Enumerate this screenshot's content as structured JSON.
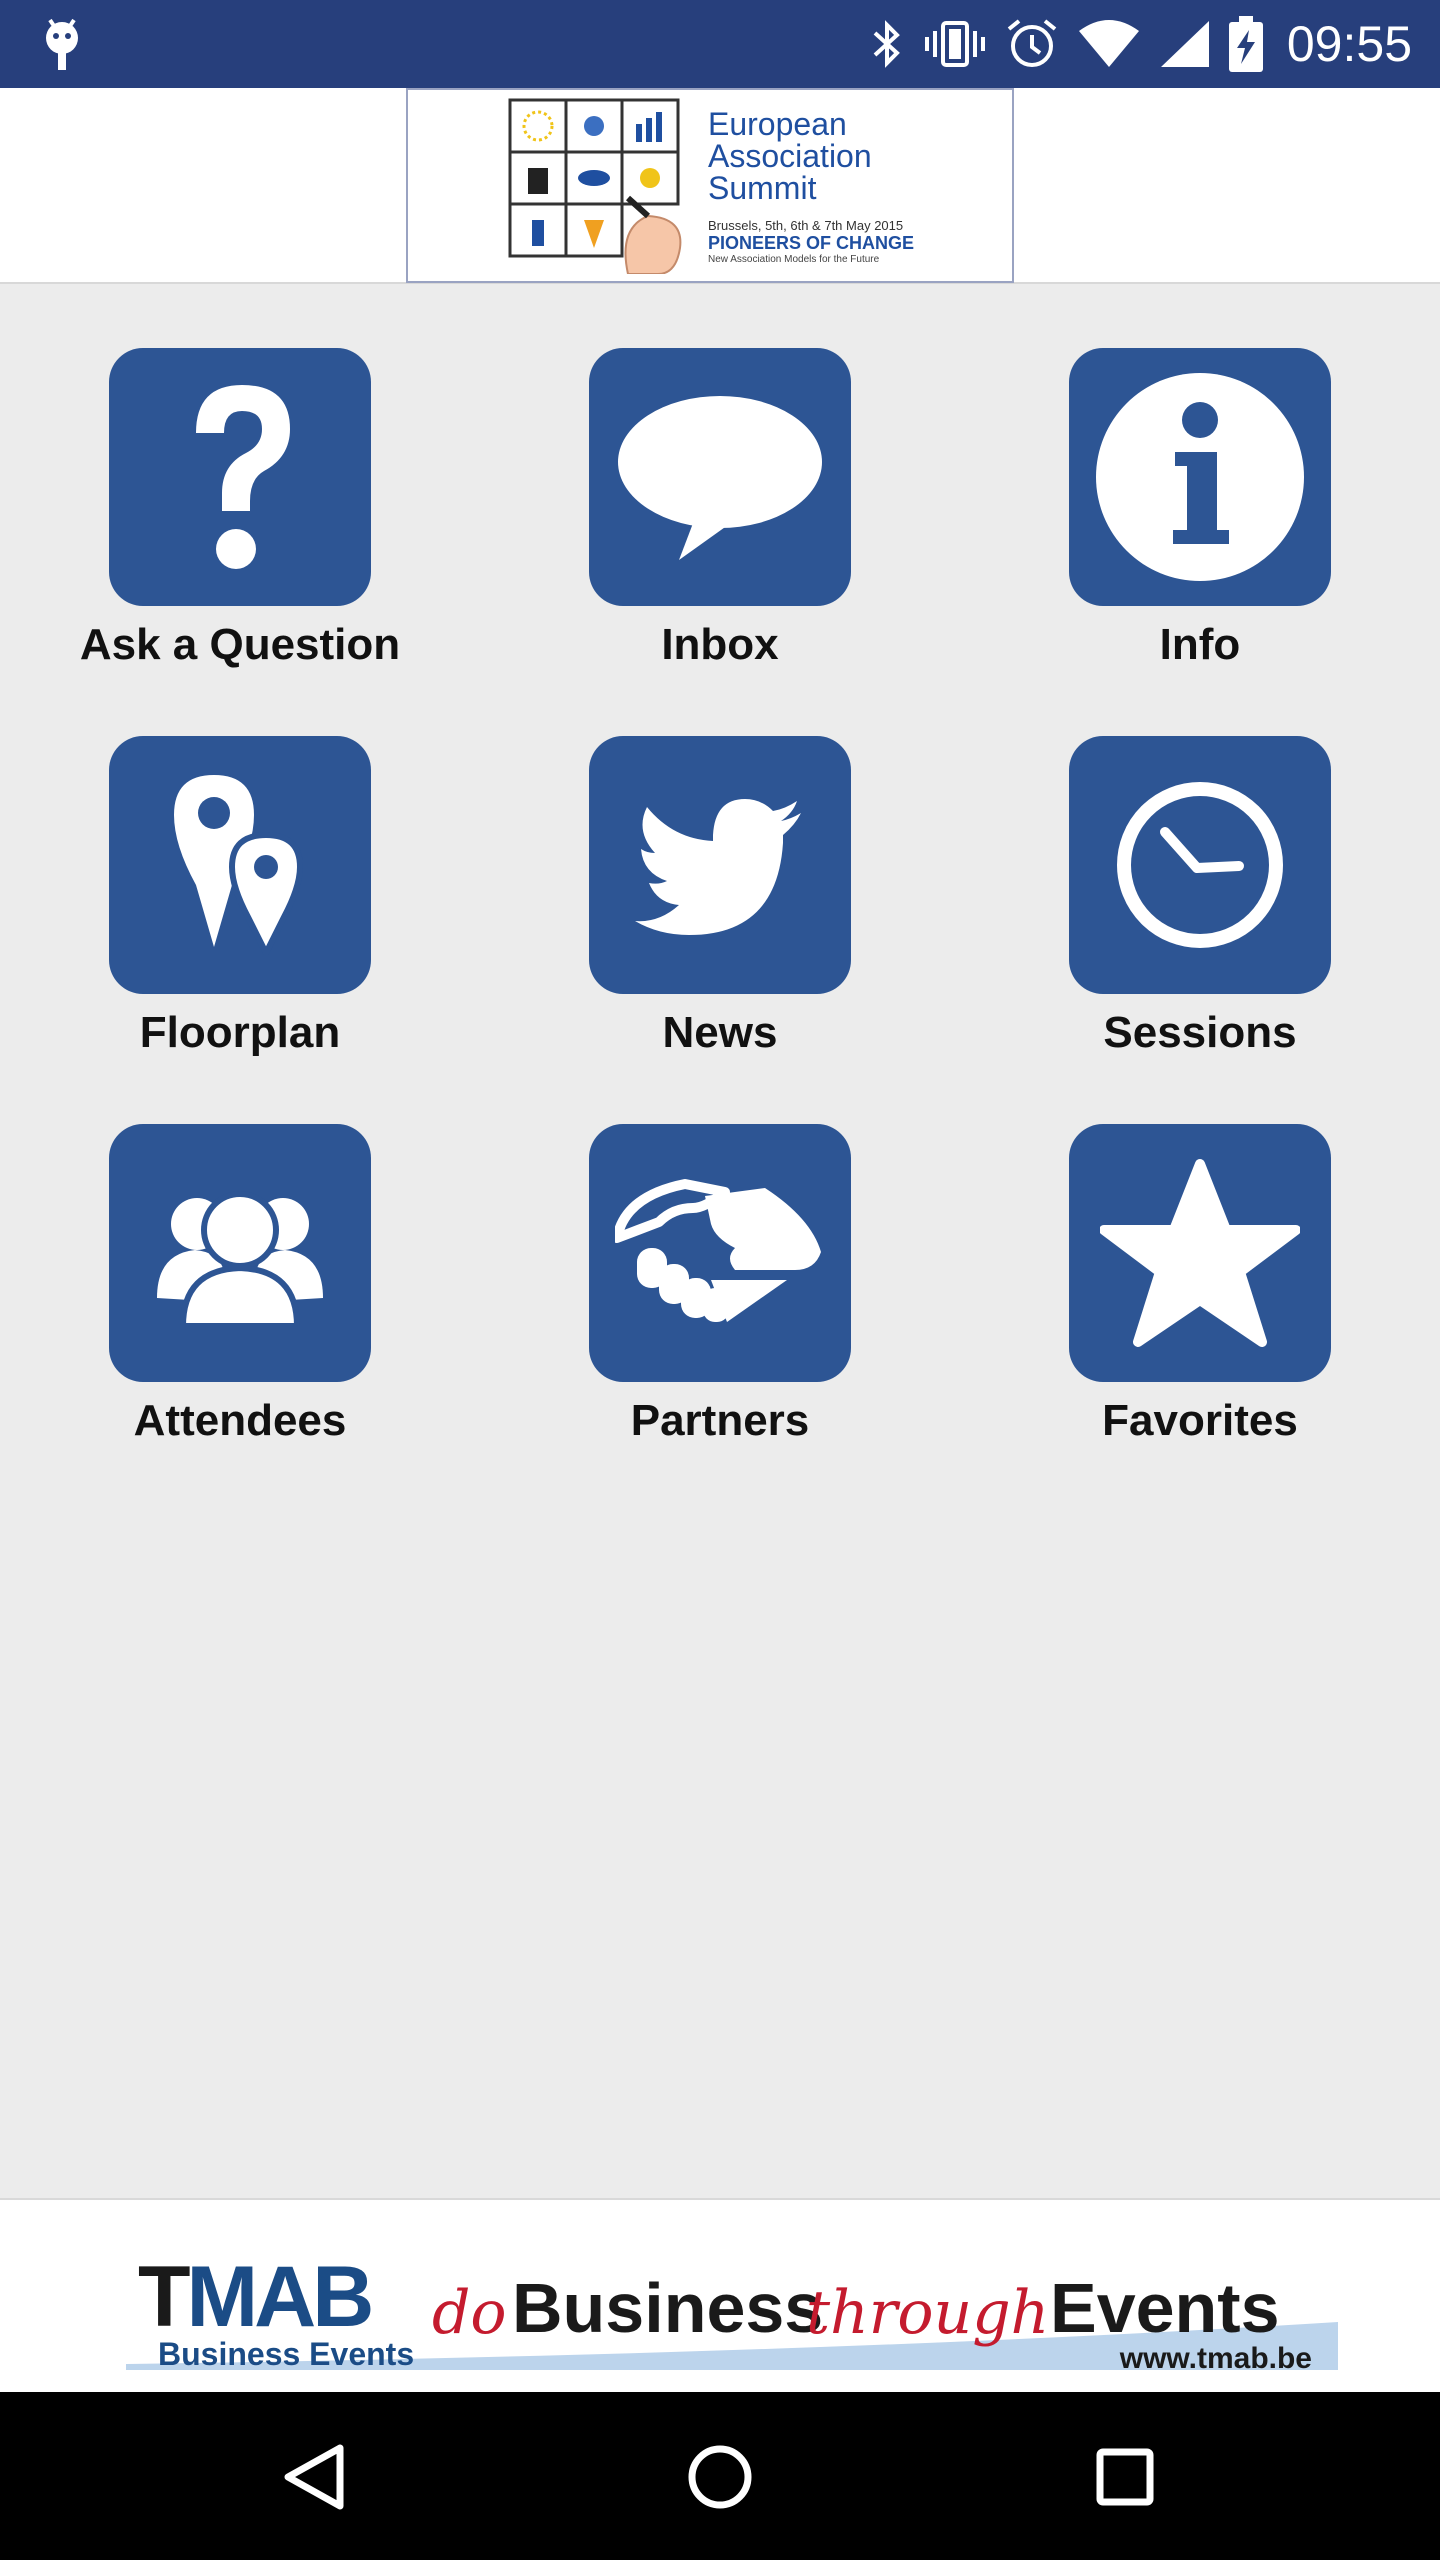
{
  "status_bar": {
    "time": "09:55",
    "icons": [
      "android-icon",
      "bluetooth-icon",
      "vibrate-icon",
      "alarm-icon",
      "wifi-icon",
      "signal-icon",
      "battery-icon"
    ]
  },
  "header": {
    "logo": {
      "line1": "European",
      "line2": "Association",
      "line3": "Summit",
      "dates": "Brussels, 5th, 6th & 7th May 2015",
      "tagline": "PIONEERS OF CHANGE",
      "subtagline": "New Association Models for the Future"
    }
  },
  "menu": {
    "items": [
      {
        "label": "Ask a Question",
        "icon": "question-icon"
      },
      {
        "label": "Inbox",
        "icon": "speech-bubble-icon"
      },
      {
        "label": "Info",
        "icon": "info-icon"
      },
      {
        "label": "Floorplan",
        "icon": "map-pins-icon"
      },
      {
        "label": "News",
        "icon": "twitter-bird-icon"
      },
      {
        "label": "Sessions",
        "icon": "clock-icon"
      },
      {
        "label": "Attendees",
        "icon": "people-icon"
      },
      {
        "label": "Partners",
        "icon": "handshake-icon"
      },
      {
        "label": "Favorites",
        "icon": "star-icon"
      }
    ]
  },
  "footer_banner": {
    "brand": "MAB",
    "brand_initial": "T",
    "brand_sub": "Business Events",
    "slogan_do": "do",
    "slogan_business": "Business",
    "slogan_through": "through",
    "slogan_events": "Events",
    "url": "www.tmab.be"
  },
  "colors": {
    "status_bar": "#273f7c",
    "tile": "#2d5594",
    "background": "#ececec",
    "brand_red": "#c41b2e"
  }
}
